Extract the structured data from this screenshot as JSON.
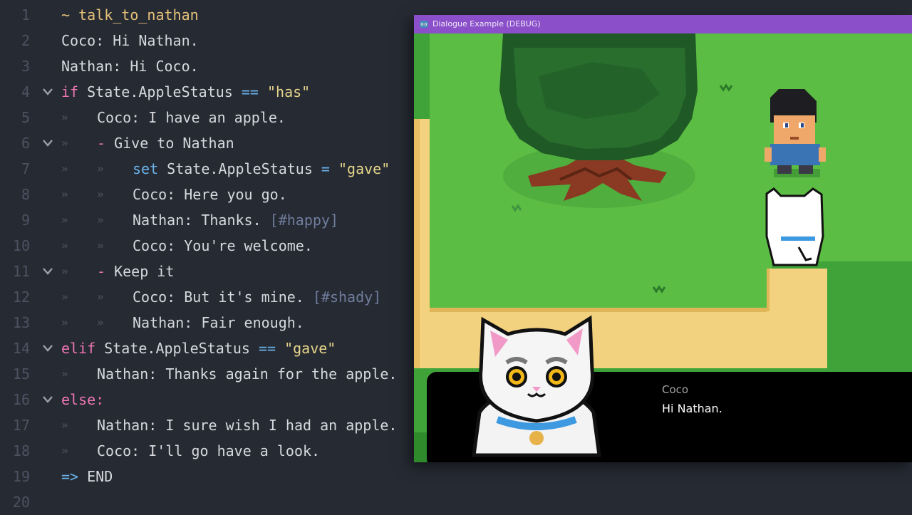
{
  "editor": {
    "lines": [
      {
        "n": "1",
        "fold": false,
        "tabs": 0,
        "parts": [
          {
            "c": "title",
            "t": "~ talk_to_nathan"
          }
        ]
      },
      {
        "n": "2",
        "fold": false,
        "tabs": 0,
        "parts": [
          {
            "c": "",
            "t": "Coco: Hi Nathan."
          }
        ]
      },
      {
        "n": "3",
        "fold": false,
        "tabs": 0,
        "parts": [
          {
            "c": "",
            "t": "Nathan: Hi Coco."
          }
        ]
      },
      {
        "n": "4",
        "fold": true,
        "tabs": 0,
        "parts": [
          {
            "c": "kw",
            "t": "if"
          },
          {
            "c": "",
            "t": " State.AppleStatus "
          },
          {
            "c": "op",
            "t": "=="
          },
          {
            "c": "",
            "t": " "
          },
          {
            "c": "str",
            "t": "\"has\""
          }
        ]
      },
      {
        "n": "5",
        "fold": false,
        "tabs": 1,
        "parts": [
          {
            "c": "",
            "t": "Coco: I have an apple."
          }
        ]
      },
      {
        "n": "6",
        "fold": true,
        "tabs": 1,
        "parts": [
          {
            "c": "kw",
            "t": "-"
          },
          {
            "c": "",
            "t": " Give to Nathan"
          }
        ]
      },
      {
        "n": "7",
        "fold": false,
        "tabs": 2,
        "parts": [
          {
            "c": "setkw",
            "t": "set"
          },
          {
            "c": "",
            "t": " State.AppleStatus "
          },
          {
            "c": "op",
            "t": "="
          },
          {
            "c": "",
            "t": " "
          },
          {
            "c": "str",
            "t": "\"gave\""
          }
        ]
      },
      {
        "n": "8",
        "fold": false,
        "tabs": 2,
        "parts": [
          {
            "c": "",
            "t": "Coco: Here you go."
          }
        ]
      },
      {
        "n": "9",
        "fold": false,
        "tabs": 2,
        "parts": [
          {
            "c": "",
            "t": "Nathan: Thanks. "
          },
          {
            "c": "tag",
            "t": "[#happy]"
          }
        ]
      },
      {
        "n": "10",
        "fold": false,
        "tabs": 2,
        "parts": [
          {
            "c": "",
            "t": "Coco: You're welcome."
          }
        ]
      },
      {
        "n": "11",
        "fold": true,
        "tabs": 1,
        "parts": [
          {
            "c": "kw",
            "t": "-"
          },
          {
            "c": "",
            "t": " Keep it"
          }
        ]
      },
      {
        "n": "12",
        "fold": false,
        "tabs": 2,
        "parts": [
          {
            "c": "",
            "t": "Coco: But it's mine. "
          },
          {
            "c": "tag",
            "t": "[#shady]"
          }
        ]
      },
      {
        "n": "13",
        "fold": false,
        "tabs": 2,
        "parts": [
          {
            "c": "",
            "t": "Nathan: Fair enough."
          }
        ]
      },
      {
        "n": "14",
        "fold": true,
        "tabs": 0,
        "parts": [
          {
            "c": "kw",
            "t": "elif"
          },
          {
            "c": "",
            "t": " State.AppleStatus "
          },
          {
            "c": "op",
            "t": "=="
          },
          {
            "c": "",
            "t": " "
          },
          {
            "c": "str",
            "t": "\"gave\""
          }
        ]
      },
      {
        "n": "15",
        "fold": false,
        "tabs": 1,
        "parts": [
          {
            "c": "",
            "t": "Nathan: Thanks again for the apple."
          }
        ]
      },
      {
        "n": "16",
        "fold": true,
        "tabs": 0,
        "parts": [
          {
            "c": "kw",
            "t": "else:"
          }
        ]
      },
      {
        "n": "17",
        "fold": false,
        "tabs": 1,
        "parts": [
          {
            "c": "",
            "t": "Nathan: I sure wish I had an apple."
          }
        ]
      },
      {
        "n": "18",
        "fold": false,
        "tabs": 1,
        "parts": [
          {
            "c": "",
            "t": "Coco: I'll go have a look."
          }
        ]
      },
      {
        "n": "19",
        "fold": false,
        "tabs": 0,
        "parts": [
          {
            "c": "op",
            "t": "=>"
          },
          {
            "c": "",
            "t": " END"
          }
        ]
      },
      {
        "n": "20",
        "fold": false,
        "tabs": 0,
        "parts": []
      }
    ],
    "tab_glyph": "»"
  },
  "game_window": {
    "title": "Dialogue Example (DEBUG)",
    "icon": "godot-icon",
    "dialogue": {
      "speaker": "Coco",
      "text": "Hi Nathan."
    }
  },
  "colors": {
    "editor_bg": "#262a33",
    "titlebar": "#8a4fc9",
    "grass": "#3fa33a",
    "path": "#f2d27e"
  }
}
